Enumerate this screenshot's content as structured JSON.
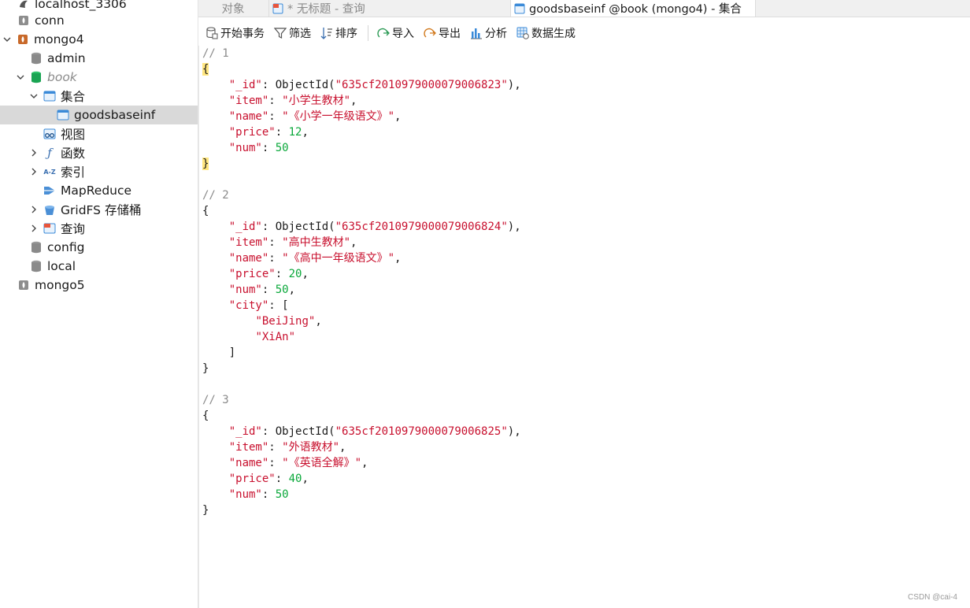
{
  "sidebar": {
    "items": [
      {
        "label": "localhost_3306",
        "icon": "mysql-connection-icon"
      },
      {
        "label": "conn",
        "icon": "mongo-connection-icon"
      },
      {
        "label": "mongo4",
        "icon": "mongo-connection-active-icon"
      },
      {
        "label": "admin",
        "icon": "database-icon"
      },
      {
        "label": "book",
        "icon": "database-open-icon"
      },
      {
        "label": "集合",
        "icon": "collections-folder-icon"
      },
      {
        "label": "goodsbaseinf",
        "icon": "collection-icon"
      },
      {
        "label": "视图",
        "icon": "views-icon"
      },
      {
        "label": "函数",
        "icon": "functions-icon"
      },
      {
        "label": "索引",
        "icon": "indexes-icon"
      },
      {
        "label": "MapReduce",
        "icon": "mapreduce-icon"
      },
      {
        "label": "GridFS 存储桶",
        "icon": "gridfs-icon"
      },
      {
        "label": "查询",
        "icon": "queries-icon"
      },
      {
        "label": "config",
        "icon": "database-icon"
      },
      {
        "label": "local",
        "icon": "database-icon"
      },
      {
        "label": "mongo5",
        "icon": "mongo-connection-icon"
      }
    ]
  },
  "tabs": [
    {
      "label": "对象"
    },
    {
      "label": "* 无标题 - 查询",
      "icon": "query-icon"
    },
    {
      "label": "goodsbaseinf @book (mongo4) - 集合",
      "icon": "collection-icon"
    }
  ],
  "toolbar": {
    "begin_transaction": "开始事务",
    "filter": "筛选",
    "sort": "排序",
    "import": "导入",
    "export": "导出",
    "analyze": "分析",
    "generate_data": "数据生成"
  },
  "documents": [
    {
      "comment": "// 1",
      "_id": "635cf2010979000079006823",
      "item": "小学生教材",
      "name": "《小学一年级语文》",
      "price": "12",
      "num": "50"
    },
    {
      "comment": "// 2",
      "_id": "635cf2010979000079006824",
      "item": "高中生教材",
      "name": "《高中一年级语文》",
      "price": "20",
      "num": "50",
      "city": [
        "BeiJing",
        "XiAn"
      ]
    },
    {
      "comment": "// 3",
      "_id": "635cf2010979000079006825",
      "item": "外语教材",
      "name": "《英语全解》",
      "price": "40",
      "num": "50"
    }
  ],
  "watermark": "CSDN @cai-4"
}
